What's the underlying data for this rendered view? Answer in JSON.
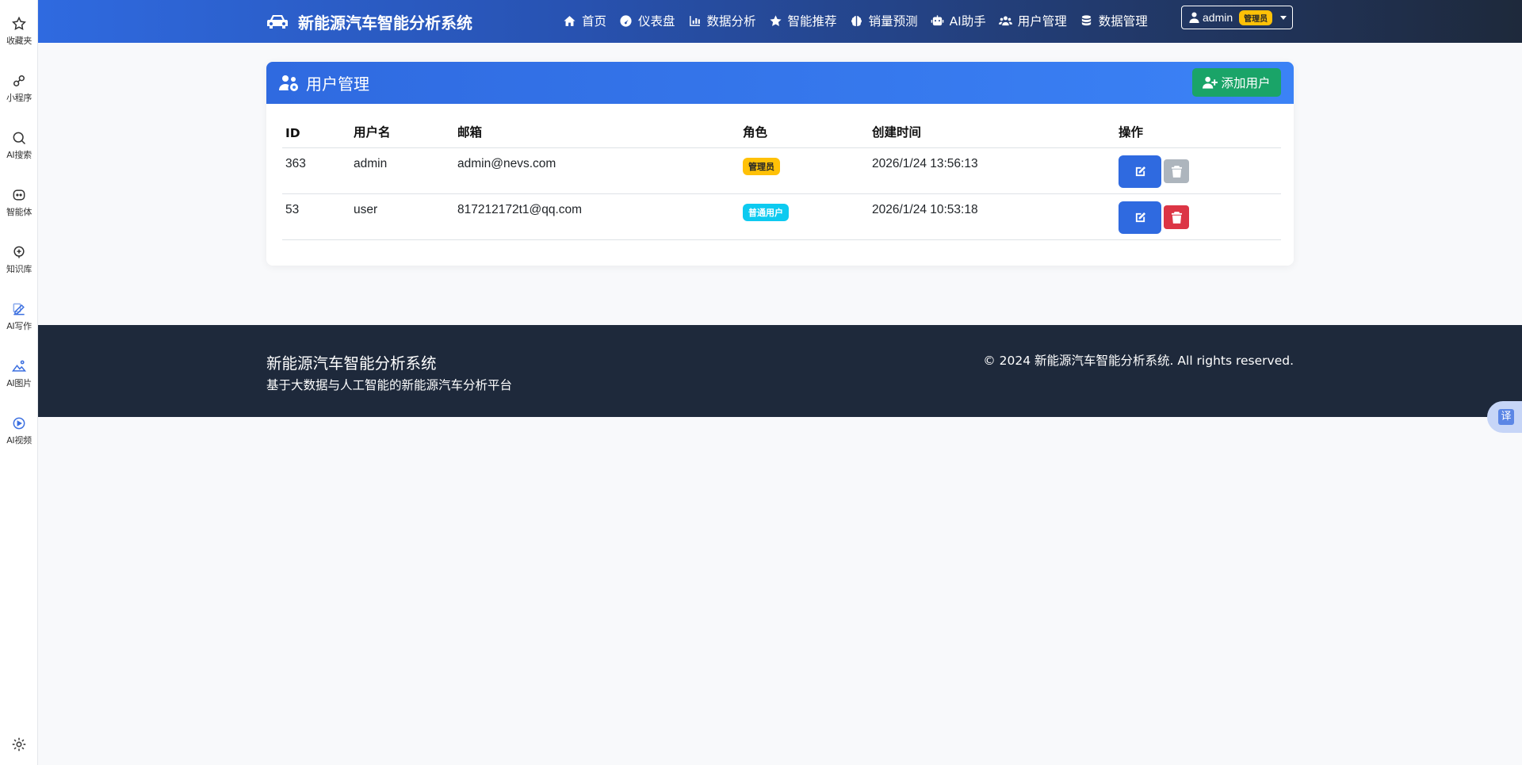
{
  "sidebar": {
    "items": [
      {
        "label": "收藏夹",
        "icon": "star-icon"
      },
      {
        "label": "小程序",
        "icon": "link-icon"
      },
      {
        "label": "AI搜索",
        "icon": "search-icon"
      },
      {
        "label": "智能体",
        "icon": "agent-icon"
      },
      {
        "label": "知识库",
        "icon": "knowledge-icon"
      },
      {
        "label": "AI写作",
        "icon": "write-icon"
      },
      {
        "label": "AI图片",
        "icon": "image-icon"
      },
      {
        "label": "AI视频",
        "icon": "video-icon"
      }
    ],
    "settings_icon": "gear-icon"
  },
  "navbar": {
    "brand": "新能源汽车智能分析系统",
    "items": [
      {
        "label": "首页",
        "icon": "home-icon"
      },
      {
        "label": "仪表盘",
        "icon": "gauge-icon"
      },
      {
        "label": "数据分析",
        "icon": "chart-icon"
      },
      {
        "label": "智能推荐",
        "icon": "star-icon"
      },
      {
        "label": "销量预测",
        "icon": "brain-icon"
      },
      {
        "label": "AI助手",
        "icon": "robot-icon"
      },
      {
        "label": "用户管理",
        "icon": "users-icon"
      },
      {
        "label": "数据管理",
        "icon": "database-icon"
      }
    ],
    "user": {
      "name": "admin",
      "badge": "管理员"
    }
  },
  "card": {
    "title": "用户管理",
    "add_button": "添加用户",
    "columns": [
      "ID",
      "用户名",
      "邮箱",
      "角色",
      "创建时间",
      "操作"
    ],
    "rows": [
      {
        "id": "363",
        "username": "admin",
        "email": "admin@nevs.com",
        "role": "管理员",
        "role_type": "admin",
        "created": "2026/1/24 13:56:13"
      },
      {
        "id": "53",
        "username": "user",
        "email": "817212172t1@qq.com",
        "role": "普通用户",
        "role_type": "user",
        "created": "2026/1/24 10:53:18"
      }
    ]
  },
  "footer": {
    "title": "新能源汽车智能分析系统",
    "subtitle": "基于大数据与人工智能的新能源汽车分析平台",
    "copyright": "© 2024 新能源汽车智能分析系统. All rights reserved."
  },
  "translate_label": "译",
  "colors": {
    "primary": "#2f6ae0",
    "success": "#1aa468",
    "danger": "#dc3545",
    "warning": "#ffc107",
    "info": "#0dcaf0",
    "footer_bg": "#1e293b"
  }
}
